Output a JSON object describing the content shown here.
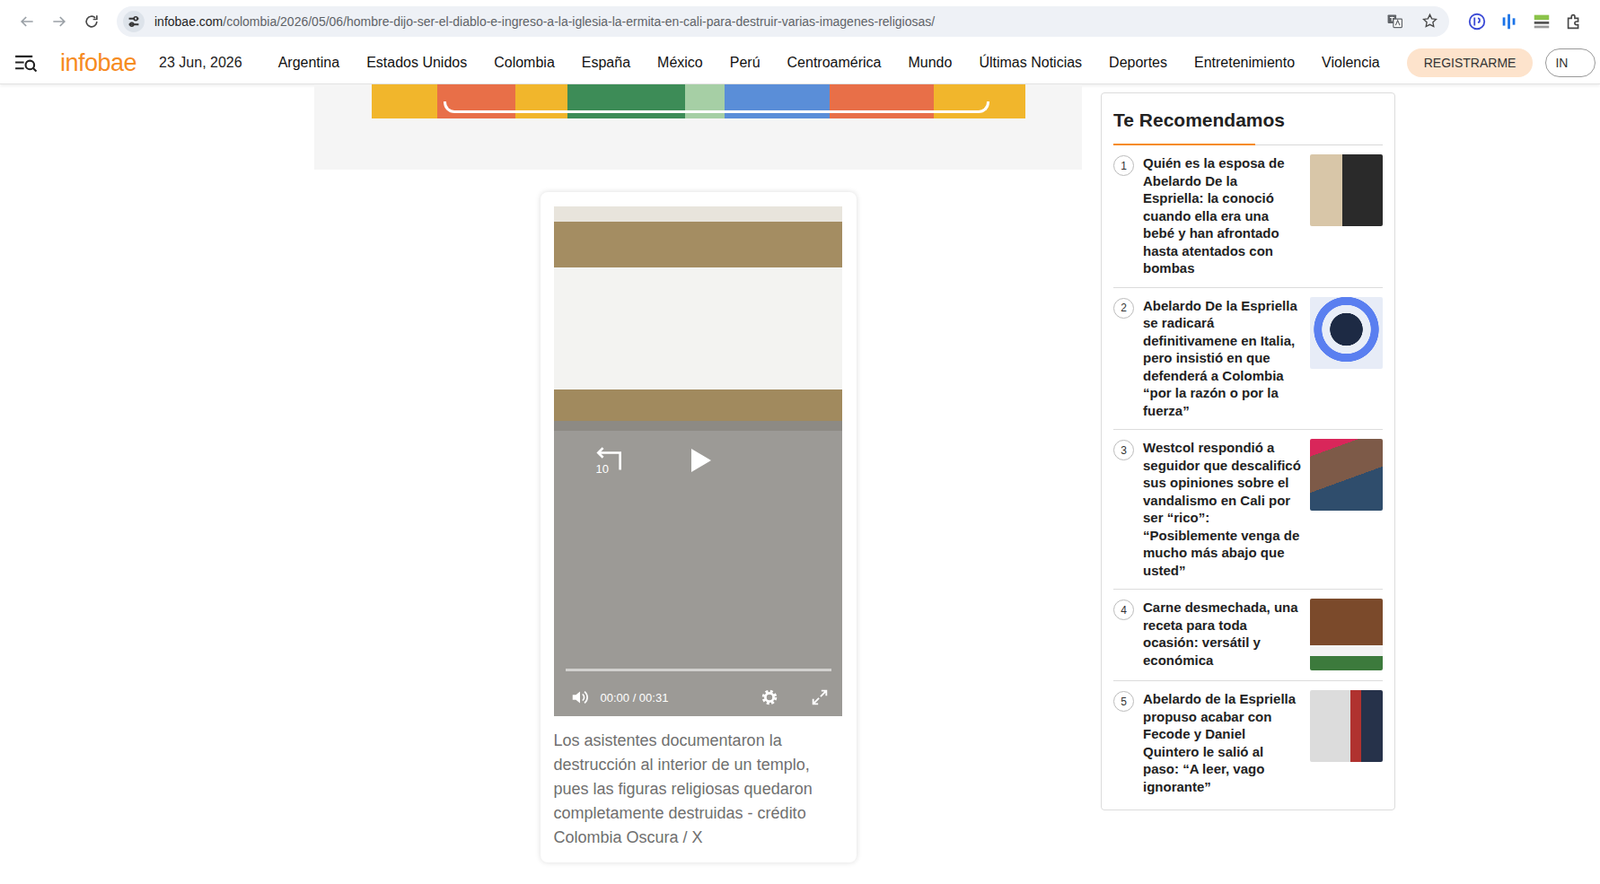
{
  "browser": {
    "url_domain": "infobae.com",
    "url_path": "/colombia/2026/05/06/hombre-dijo-ser-el-diablo-e-ingreso-a-la-iglesia-la-ermita-en-cali-para-destruir-varias-imagenes-religiosas/",
    "bookmarked": false
  },
  "site": {
    "logo": "infobae",
    "date": "23 Jun, 2026",
    "nav": [
      "Argentina",
      "Estados Unidos",
      "Colombia",
      "España",
      "México",
      "Perú",
      "Centroamérica",
      "Mundo",
      "Últimas Noticias",
      "Deportes",
      "Entretenimiento",
      "Violencia"
    ],
    "register_button": "REGISTRARME",
    "login_button": "IN"
  },
  "video": {
    "replay_label": "10",
    "playing": false,
    "level": 0,
    "time": "00:00 / 00:31",
    "caption": "Los asistentes documentaron la destrucción al interior de un templo, pues las figuras religiosas quedaron completamente destruidas - crédito Colombia Oscura / X"
  },
  "sidebar": {
    "title": "Te Recomendamos",
    "items": [
      {
        "number": "1",
        "title": "Quién es la esposa de Abelardo De la Espriella: la conoció cuando ella era una bebé y han afrontado hasta atentados con bombas"
      },
      {
        "number": "2",
        "title": "Abelardo De la Espriella se radicará definitivamene en Italia, pero insistió en que defenderá a Colombia “por la razón o por la fuerza”"
      },
      {
        "number": "3",
        "title": "Westcol respondió a seguidor que descalificó sus opiniones sobre el vandalismo en Cali por ser “rico”: “Posiblemente venga de mucho más abajo que usted”"
      },
      {
        "number": "4",
        "title": "Carne desmechada, una receta para toda ocasión: versátil y económica"
      },
      {
        "number": "5",
        "title": "Abelardo de la Espriella propuso acabar con Fecode y Daniel Quintero le salió al paso: “A leer, vago ignorante”"
      }
    ]
  }
}
